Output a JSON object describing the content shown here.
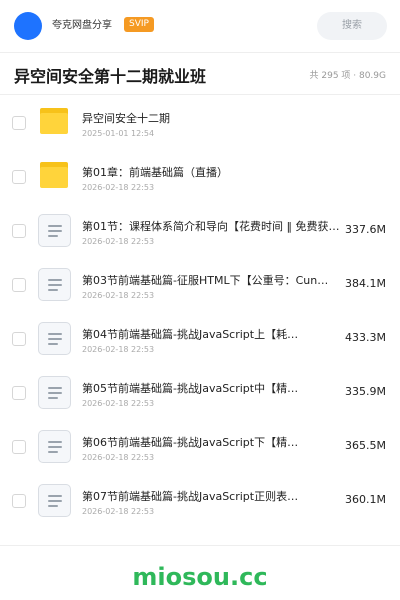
{
  "header": {
    "user_name": "夸克网盘分享",
    "badge": "SVIP",
    "search_placeholder": "搜索",
    "avatar_color": "#1e73ff"
  },
  "folder": {
    "title": "异空间安全第十二期就业班",
    "summary": "共 295 项 · 80.9G"
  },
  "files": [
    {
      "type": "folder",
      "name": "异空间安全十二期",
      "date": "2025-01-01 12:54",
      "size": ""
    },
    {
      "type": "folder",
      "name": "第01章：前端基础篇（直播）",
      "date": "2026-02-18 22:53",
      "size": ""
    },
    {
      "type": "file",
      "name": "第01节：课程体系简介和导向【花费时间 ‖ 免费获取：…",
      "date": "2026-02-18 22:53",
      "size": "337.6M"
    },
    {
      "type": "file",
      "name": "第03节前端基础篇-征服HTML下【公重号：Cun…",
      "date": "2026-02-18 22:53",
      "size": "384.1M"
    },
    {
      "type": "file",
      "name": "第04节前端基础篇-挑战JavaScript上【耗…",
      "date": "2026-02-18 22:53",
      "size": "433.3M"
    },
    {
      "type": "file",
      "name": "第05节前端基础篇-挑战JavaScript中【精…",
      "date": "2026-02-18 22:53",
      "size": "335.9M"
    },
    {
      "type": "file",
      "name": "第06节前端基础篇-挑战JavaScript下【精…",
      "date": "2026-02-18 22:53",
      "size": "365.5M"
    },
    {
      "type": "file",
      "name": "第07节前端基础篇-挑战JavaScript正则表…",
      "date": "2026-02-18 22:53",
      "size": "360.1M"
    }
  ],
  "watermark": "miosou.cc",
  "colors": {
    "badge": "#f59a23",
    "folder": "#ffd43b",
    "watermark": "#2fb85a"
  }
}
